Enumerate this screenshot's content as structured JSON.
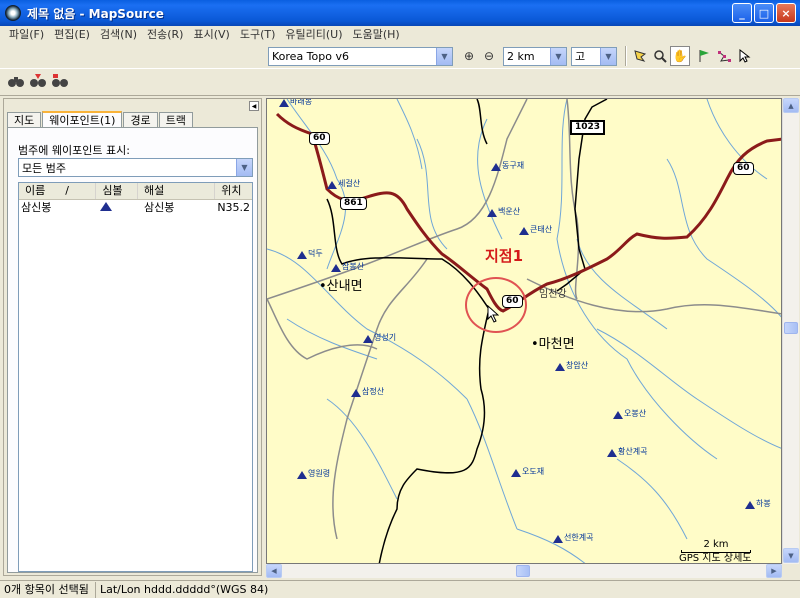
{
  "window": {
    "title": "제목 없음 - MapSource",
    "min": "_",
    "max": "□",
    "close": "×"
  },
  "menu": [
    "파일(F)",
    "편집(E)",
    "검색(N)",
    "전송(R)",
    "표시(V)",
    "도구(T)",
    "유틸리티(U)",
    "도움말(H)"
  ],
  "toolbar": {
    "map_product": "Korea Topo v6",
    "zoom_scale": "2 km",
    "detail": "고"
  },
  "icons": {
    "zoom_in": "zoom-in-icon",
    "zoom_out": "zoom-out-icon",
    "select": "select-tool-icon",
    "zoom_tool": "zoom-tool-icon",
    "hand": "hand-tool-icon",
    "waypoint": "waypoint-flag-icon",
    "route": "route-tool-icon",
    "pointer": "pointer-icon",
    "find1": "binoculars-icon",
    "find2": "find-next-icon",
    "find3": "find-places-icon"
  },
  "panel": {
    "tabs": [
      "지도",
      "웨이포인트(1)",
      "경로",
      "트랙"
    ],
    "active_tab": 1,
    "category_label": "범주에 웨이포인트 표시:",
    "category_value": "모든 범주",
    "columns": [
      "이름",
      "심볼",
      "해설",
      "위치"
    ],
    "rows": [
      {
        "name": "삼신봉",
        "comment": "삼신봉",
        "position": "N35.2"
      }
    ]
  },
  "map": {
    "annotation": "지점1",
    "towns": [
      "산내면",
      "마천면"
    ],
    "river": "임천강",
    "shields": [
      "60",
      "861",
      "1023",
      "60",
      "60"
    ],
    "peaks": [
      "바래봉",
      "동구재",
      "세걸산",
      "백운산",
      "큰태산",
      "덕두",
      "삼봉산",
      "영성기",
      "삼정산",
      "영원령",
      "창암산",
      "오도재",
      "오봉산",
      "황산계곡",
      "선한계곡",
      "하봉"
    ],
    "scale_label": "2 km",
    "footer_text": "GPS 지도 상세도"
  },
  "status": {
    "selection": "0개 항목이 선택됨",
    "format": "Lat/Lon hddd.ddddd°(WGS 84)"
  },
  "colors": {
    "title_bar": "#0a58d6",
    "map_bg": "#fffcc8",
    "track": "#8b1a1a",
    "annotation": "#d41a1a"
  }
}
